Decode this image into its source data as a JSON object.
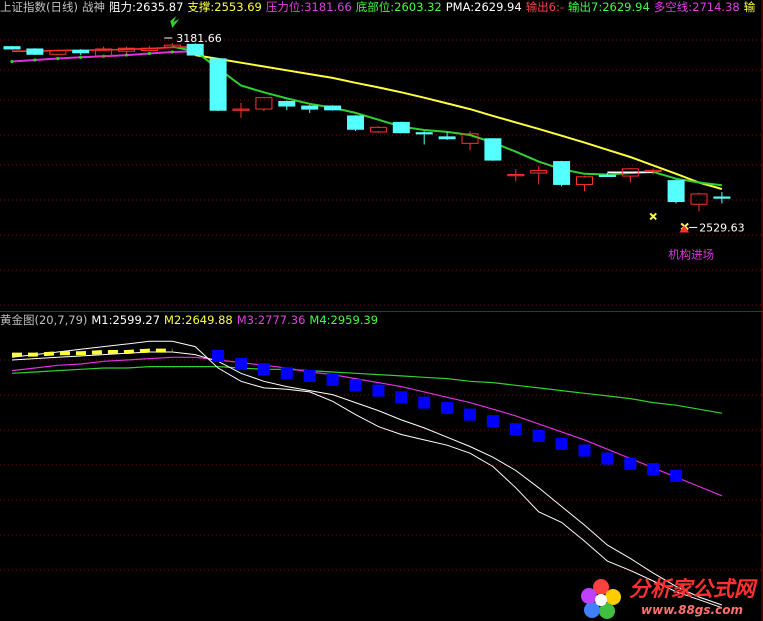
{
  "header_top": {
    "index_name": "上证指数(日线)",
    "indicator": "战神",
    "resistance": "阻力:2635.87",
    "support": "支撑:2553.69",
    "pressure": "压力位:3181.66",
    "bottom": "底部位:2603.32",
    "pma": "PMA:2629.94",
    "out6": "输出6:-",
    "out7": "输出7:2629.94",
    "longshort": "多空线:2714.38",
    "extra": "输"
  },
  "header_bottom": {
    "name": "黄金图(20,7,79)",
    "m1": "M1:2599.27",
    "m2": "M2:2649.88",
    "m3": "M3:2777.36",
    "m4": "M4:2959.39"
  },
  "colors": {
    "up": "#ff3030",
    "down": "#54ffff",
    "yellow": "#ffff40",
    "green": "#30d030",
    "magenta": "#e030e0",
    "white": "#ffffff",
    "grid": "#8a0000",
    "blue": "#0000ff",
    "orange": "#ff9900"
  },
  "annotations": {
    "high_label": "3181.66",
    "low_label": "2529.63",
    "signal_text": "机构进场"
  },
  "watermark": {
    "title": "分析家公式网",
    "url": "www.88gs.com"
  },
  "chart_data": [
    {
      "type": "candlestick",
      "series": [
        {
          "name": "candles",
          "ohlc": [
            [
              3172,
              3166,
              3174,
              3164
            ],
            [
              3166,
              3152,
              3168,
              3150
            ],
            [
              3152,
              3162,
              3164,
              3150
            ],
            [
              3162,
              3156,
              3165,
              3150
            ],
            [
              3148,
              3166,
              3172,
              3146
            ],
            [
              3160,
              3168,
              3172,
              3154
            ],
            [
              3162,
              3168,
              3174,
              3160
            ],
            [
              3171,
              3176,
              3181.66,
              3168
            ],
            [
              3178,
              3150,
              3181,
              3148
            ],
            [
              3140,
              3005,
              3142,
              3003
            ],
            [
              3006,
              3008,
              3024,
              2985
            ],
            [
              3008,
              3038,
              3040,
              3003
            ],
            [
              3028,
              3016,
              3031,
              3005
            ],
            [
              3016,
              3008,
              3019,
              2998
            ],
            [
              3016,
              3006,
              3018,
              3004
            ],
            [
              2990,
              2955,
              2992,
              2950
            ],
            [
              2948,
              2960,
              2963,
              2945
            ],
            [
              2973,
              2946,
              2975,
              2944
            ],
            [
              2946,
              2945,
              2950,
              2915
            ],
            [
              2935,
              2930,
              2947,
              2927
            ],
            [
              2918,
              2943,
              2950,
              2900
            ],
            [
              2930,
              2874,
              2931,
              2872
            ],
            [
              2836,
              2836,
              2850,
              2818
            ],
            [
              2840,
              2847,
              2858,
              2810
            ],
            [
              2870,
              2810,
              2872,
              2805
            ],
            [
              2810,
              2830,
              2833,
              2792
            ],
            [
              2834,
              2832,
              2840,
              2830
            ],
            [
              2832,
              2851,
              2853,
              2815
            ],
            [
              2847,
              2847,
              2852,
              2836
            ],
            [
              2820,
              2765,
              2823,
              2760
            ],
            [
              2758,
              2785,
              2788,
              2740
            ],
            [
              2777,
              2775,
              2790,
              2760
            ]
          ]
        },
        {
          "name": "多空线",
          "values": [
            null,
            null,
            null,
            null,
            null,
            null,
            null,
            null,
            3150,
            3140,
            3130,
            3120,
            3110,
            3100,
            3090,
            3077,
            3065,
            3052,
            3038,
            3023,
            3008,
            2990,
            2973,
            2956,
            2938,
            2920,
            2901,
            2882,
            2860,
            2838,
            2815,
            2798
          ]
        },
        {
          "name": "PMA",
          "values": [
            null,
            null,
            null,
            null,
            null,
            null,
            null,
            3172,
            3160,
            3115,
            3070,
            3052,
            3036,
            3022,
            3012,
            2998,
            2980,
            2962,
            2953,
            2948,
            2940,
            2920,
            2896,
            2870,
            2850,
            2838,
            2836,
            2840,
            2843,
            2825,
            2815,
            2808
          ]
        },
        {
          "name": "line_red",
          "values": [
            3160,
            3160,
            3162,
            3163,
            3163,
            3165,
            3167,
            3170,
            3172
          ]
        },
        {
          "name": "line_magenta",
          "values": [
            3133,
            3137,
            3141,
            3144,
            3147,
            3150,
            3154,
            3158,
            3160
          ]
        },
        {
          "name": "line_white",
          "values": [
            null,
            null,
            null,
            null,
            null,
            null,
            null,
            null,
            null,
            null,
            null,
            null,
            null,
            null,
            null,
            null,
            null,
            null,
            null,
            null,
            null,
            null,
            null,
            null,
            null,
            null,
            2842,
            2842,
            2842
          ]
        }
      ],
      "ylim": [
        2480,
        3250
      ]
    },
    {
      "type": "line",
      "series": [
        {
          "name": "M1",
          "values": [
            98,
            100,
            102,
            104,
            106,
            108,
            110,
            110,
            106,
            90,
            80,
            75,
            74,
            72,
            65,
            55,
            46,
            40,
            36,
            32,
            26,
            16,
            0,
            -18,
            -26,
            -40,
            -55,
            -62,
            -70,
            -78,
            -84,
            -90
          ]
        },
        {
          "name": "M2",
          "values": [
            96,
            97,
            98,
            99,
            100,
            101,
            102,
            102,
            100,
            95,
            86,
            80,
            76,
            73,
            70,
            64,
            58,
            51,
            45,
            38,
            31,
            23,
            13,
            0,
            -14,
            -28,
            -43,
            -53,
            -64,
            -74,
            -82,
            -88
          ]
        },
        {
          "name": "M3",
          "values": [
            88,
            90,
            92,
            93,
            95,
            96,
            97,
            98,
            98,
            96,
            94,
            92,
            90,
            87,
            85,
            82,
            79,
            76,
            72,
            68,
            64,
            59,
            54,
            48,
            42,
            36,
            29,
            22,
            15,
            8,
            1,
            -6
          ]
        },
        {
          "name": "M4",
          "values": [
            86,
            87,
            88,
            89,
            90,
            90,
            91,
            91,
            91,
            91,
            90,
            89,
            89,
            88,
            87,
            86,
            85,
            84,
            83,
            82,
            80,
            79,
            77,
            75,
            73,
            71,
            69,
            67,
            64,
            62,
            59,
            56
          ]
        },
        {
          "name": "yellow_dash",
          "values": [
            100,
            100,
            101,
            101,
            102,
            102,
            103,
            103,
            null
          ]
        },
        {
          "name": "blue_boxes",
          "values": [
            null,
            null,
            null,
            null,
            null,
            null,
            null,
            null,
            null,
            99,
            93,
            89,
            86,
            84,
            81,
            77,
            73,
            68,
            64,
            60,
            55,
            50,
            44,
            39,
            33,
            28,
            22,
            18,
            14,
            9,
            null,
            null
          ]
        }
      ],
      "ylim": [
        -100,
        120
      ]
    }
  ]
}
